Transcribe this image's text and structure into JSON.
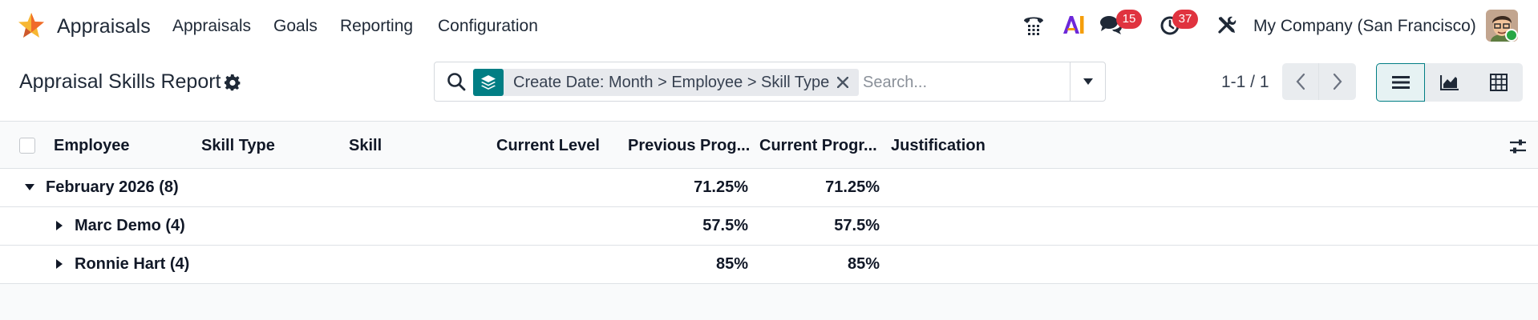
{
  "navbar": {
    "app_name": "Appraisals",
    "menu": [
      "Appraisals",
      "Goals",
      "Reporting",
      "Configuration"
    ],
    "messages_count": "15",
    "activities_count": "37",
    "company": "My Company (San Francisco)",
    "icons": [
      "phone-icon",
      "ai-icon",
      "chat-icon",
      "clock-icon",
      "tools-icon"
    ]
  },
  "control_panel": {
    "title": "Appraisal Skills Report",
    "search": {
      "facet": "Create Date: Month > Employee > Skill Type",
      "placeholder": "Search..."
    },
    "pager": "1-1 / 1"
  },
  "list": {
    "columns": [
      "Employee",
      "Skill Type",
      "Skill",
      "Current Level",
      "Previous Prog...",
      "Current Progr...",
      "Justification"
    ],
    "groups": [
      {
        "label": "February 2026 (8)",
        "previous": "71.25%",
        "current": "71.25%",
        "expanded": true,
        "level": 0
      },
      {
        "label": "Marc Demo (4)",
        "previous": "57.5%",
        "current": "57.5%",
        "expanded": false,
        "level": 1
      },
      {
        "label": "Ronnie Hart (4)",
        "previous": "85%",
        "current": "85%",
        "expanded": false,
        "level": 1
      }
    ]
  },
  "colors": {
    "accent": "#017e84",
    "badge": "#e0333f",
    "logo_orange": "#f06a2a",
    "logo_yellow": "#f7b733"
  }
}
